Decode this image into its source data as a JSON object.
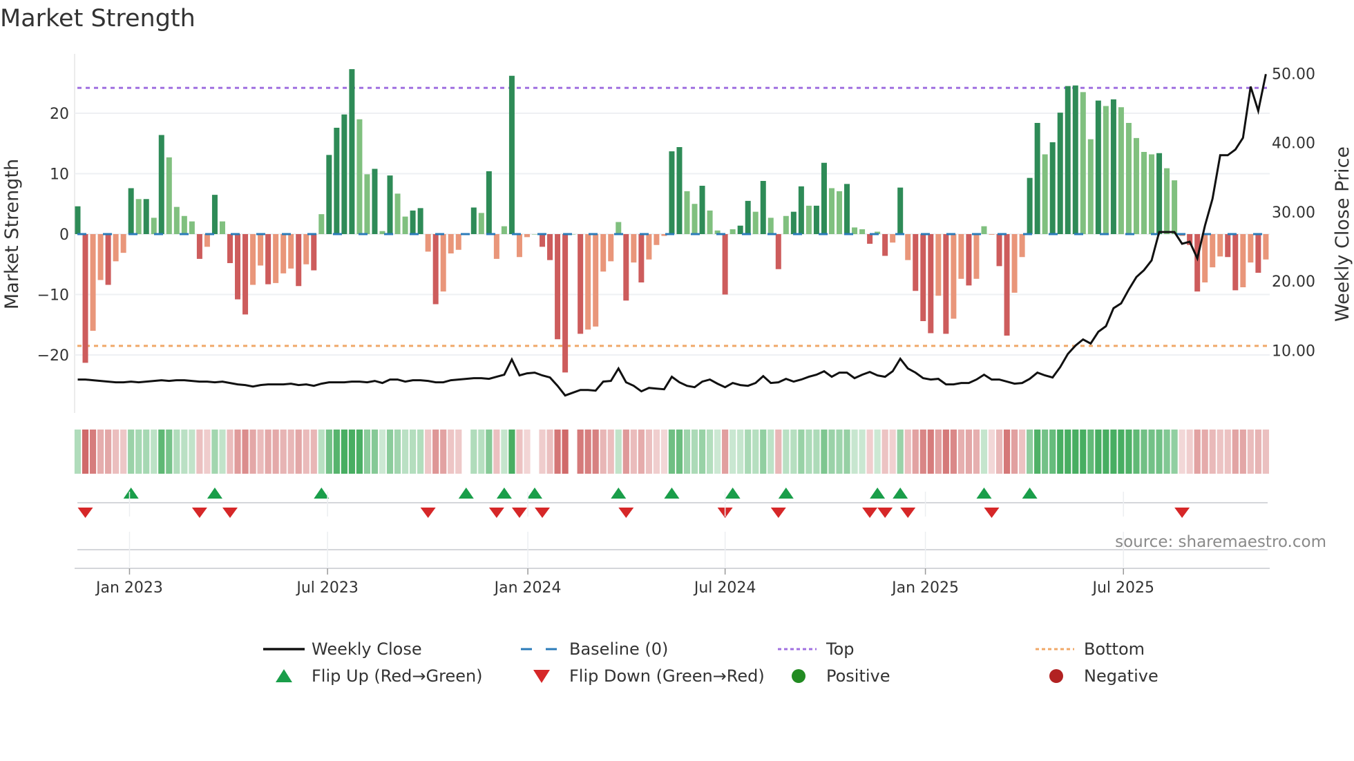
{
  "chart_data": {
    "type": "bar",
    "title": "Market Strength",
    "ylabel": "Market Strength",
    "y2label": "Weekly Close Price",
    "ylim": [
      -29,
      29.5
    ],
    "y2lim": [
      2,
      52
    ],
    "yticks": [
      {
        "value": 20,
        "label": "20"
      },
      {
        "value": 10,
        "label": "10"
      },
      {
        "value": 0,
        "label": "0"
      },
      {
        "value": -10,
        "label": "−10"
      },
      {
        "value": -20,
        "label": "−20"
      }
    ],
    "y2ticks": [
      {
        "value": 50,
        "label": "50.00"
      },
      {
        "value": 40,
        "label": "40.00"
      },
      {
        "value": 30,
        "label": "30.00"
      },
      {
        "value": 20,
        "label": "20.00"
      },
      {
        "value": 10,
        "label": "10.00"
      }
    ],
    "x_frequency": "weekly",
    "x_ticks": [
      {
        "label": "Jan 2023",
        "week_index": 6.8
      },
      {
        "label": "Jul 2023",
        "week_index": 32.8
      },
      {
        "label": "Jan 2024",
        "week_index": 59.1
      },
      {
        "label": "Jul 2024",
        "week_index": 85.0
      },
      {
        "label": "Jan 2025",
        "week_index": 111.3
      },
      {
        "label": "Jul 2025",
        "week_index": 137.3
      }
    ],
    "top_level": 24.2,
    "bottom_level": -18.5,
    "strength": [
      4.6,
      -21.3,
      -16,
      -7.6,
      -8.4,
      -4.5,
      -3.1,
      7.6,
      5.8,
      5.8,
      2.7,
      16.4,
      12.7,
      4.5,
      3,
      2.1,
      -4.1,
      -2.1,
      6.5,
      2.1,
      -4.8,
      -10.8,
      -13.3,
      -8.4,
      -5.2,
      -8.3,
      -8.1,
      -6.5,
      -5.7,
      -8.6,
      -5,
      -6,
      3.3,
      13.1,
      17.6,
      19.8,
      27.3,
      19,
      9.9,
      10.8,
      0.5,
      9.7,
      6.7,
      2.9,
      3.9,
      4.3,
      -2.9,
      -11.6,
      -9.5,
      -3.2,
      -2.6,
      0,
      4.4,
      3.5,
      10.4,
      -4.1,
      1.3,
      26.2,
      -3.8,
      -0.5,
      0,
      -2.1,
      -4.3,
      -17.4,
      -22.9,
      0,
      -16.5,
      -15.8,
      -15.3,
      -6.2,
      -4.5,
      2,
      -11,
      -4.7,
      -8,
      -4.2,
      -1.8,
      -0.3,
      13.7,
      14.4,
      7.1,
      5,
      8,
      3.9,
      0.6,
      -10,
      0.8,
      1.4,
      5.5,
      3.7,
      8.8,
      2.7,
      -5.8,
      3,
      3.7,
      7.9,
      4.7,
      4.7,
      11.8,
      7.6,
      7.1,
      8.3,
      1.1,
      0.8,
      -1.6,
      0.4,
      -3.6,
      -1.4,
      7.7,
      -4.3,
      -9.4,
      -14.4,
      -16.4,
      -10.2,
      -16.5,
      -14,
      -7.4,
      -8.5,
      -7.4,
      1.3,
      -0.1,
      -5.3,
      -16.8,
      -9.7,
      -3.8,
      9.3,
      18.4,
      13.2,
      15.2,
      20.1,
      24.5,
      24.6,
      23.5,
      15.7,
      22.1,
      21.2,
      22.3,
      21,
      18.4,
      15.9,
      13.6,
      13.2,
      13.4,
      10.9,
      8.9,
      -0.3,
      -1.8,
      -9.5,
      -8,
      -5.5,
      -3.7,
      -3.8,
      -9.3,
      -8.8,
      -4.7,
      -6.4,
      -4.2
    ],
    "weekly_close": [
      5.8,
      5.8,
      5.7,
      5.6,
      5.5,
      5.4,
      5.4,
      5.5,
      5.4,
      5.5,
      5.6,
      5.7,
      5.6,
      5.7,
      5.7,
      5.6,
      5.5,
      5.5,
      5.4,
      5.5,
      5.3,
      5.1,
      5.0,
      4.8,
      5.0,
      5.1,
      5.1,
      5.1,
      5.2,
      5.0,
      5.1,
      4.9,
      5.2,
      5.4,
      5.4,
      5.4,
      5.5,
      5.5,
      5.4,
      5.6,
      5.3,
      5.8,
      5.8,
      5.5,
      5.7,
      5.7,
      5.6,
      5.4,
      5.4,
      5.7,
      5.8,
      5.9,
      6.0,
      6.0,
      5.9,
      6.2,
      6.5,
      8.7,
      6.4,
      6.7,
      6.8,
      6.4,
      6.1,
      4.9,
      3.5,
      3.9,
      4.3,
      4.3,
      4.2,
      5.5,
      5.6,
      7.4,
      5.4,
      4.9,
      4.1,
      4.6,
      4.5,
      4.4,
      6.2,
      5.4,
      4.9,
      4.7,
      5.5,
      5.8,
      5.2,
      4.7,
      5.3,
      5.0,
      4.9,
      5.3,
      6.3,
      5.3,
      5.4,
      5.9,
      5.5,
      5.8,
      6.2,
      6.5,
      7.0,
      6.2,
      6.8,
      6.8,
      6.0,
      6.5,
      6.9,
      6.4,
      6.2,
      7.0,
      8.8,
      7.4,
      6.8,
      6.0,
      5.8,
      5.9,
      5.1,
      5.1,
      5.3,
      5.3,
      5.8,
      6.5,
      5.8,
      5.8,
      5.5,
      5.2,
      5.3,
      5.9,
      6.8,
      6.4,
      6.1,
      7.6,
      9.5,
      10.7,
      11.6,
      11.0,
      12.7,
      13.5,
      16.1,
      16.8,
      18.8,
      20.6,
      21.6,
      23.0,
      27.1,
      27.1,
      27.1,
      25.4,
      25.7,
      23.3,
      28.0,
      31.9,
      38.2,
      38.2,
      39.0,
      40.7,
      48.1,
      44.6,
      49.9
    ],
    "flip_up_weeks": [
      7,
      18,
      32,
      51,
      56,
      60,
      71,
      78,
      86,
      93,
      105,
      108,
      119,
      125
    ],
    "flip_down_weeks": [
      1,
      16,
      20,
      46,
      55,
      58,
      61,
      72,
      85,
      92,
      104,
      106,
      109,
      120,
      145
    ],
    "legend": {
      "placement": "bottom",
      "items": [
        {
          "label": "Weekly Close",
          "kind": "line",
          "color": "#111111"
        },
        {
          "label": "Baseline (0)",
          "kind": "dash",
          "color": "#2b7bb9"
        },
        {
          "label": "Top",
          "kind": "dot",
          "color": "#a070e0"
        },
        {
          "label": "Bottom",
          "kind": "dot",
          "color": "#f0a868"
        },
        {
          "label": "Flip Up (Red→Green)",
          "kind": "up",
          "color": "#1a9e4a"
        },
        {
          "label": "Flip Down (Green→Red)",
          "kind": "down",
          "color": "#d62728"
        },
        {
          "label": "Positive",
          "kind": "circle",
          "color": "#228b22"
        },
        {
          "label": "Negative",
          "kind": "circle",
          "color": "#b22222"
        }
      ]
    },
    "colors": {
      "pos_strong": "#2e8b57",
      "pos_weak": "#80c07f",
      "neg_strong": "#cd5c5c",
      "neg_weak": "#e9967a",
      "price": "#111111"
    }
  },
  "source": "source: sharemaestro.com"
}
